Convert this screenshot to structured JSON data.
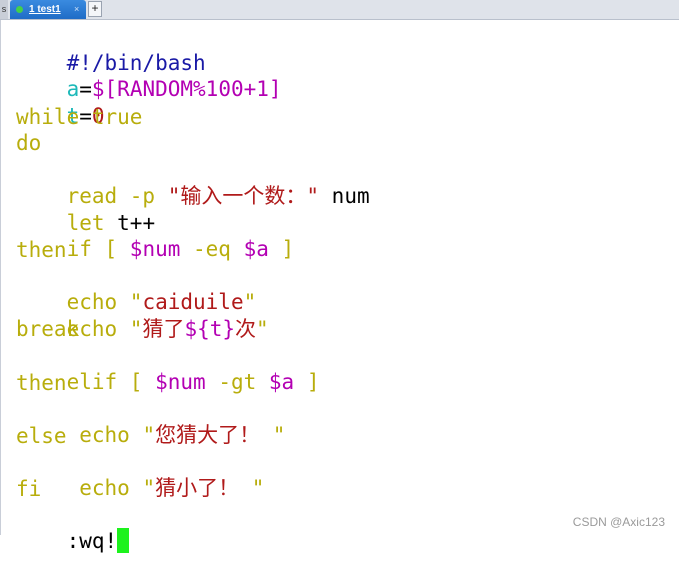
{
  "tabbar": {
    "edge_glyph": "s",
    "tab_label": "1 test1",
    "close_glyph": "×",
    "add_glyph": "+"
  },
  "terminal": {
    "l1": "#!/bin/bash",
    "l2_var": "a",
    "l2_eq": "=",
    "l2_expr": "$[RANDOM%100+1]",
    "l3_var": "t",
    "l3_eq": "=",
    "l3_val": "0",
    "l4": "while true",
    "l5": "do",
    "l6_kw": "read -p ",
    "l6_str": "\"输入一个数：\"",
    "l6_rest": " num",
    "l7_kw": "let",
    "l7_rest": " t++",
    "l8_a": "if [ ",
    "l8_var1": "$num",
    "l8_b": " -eq ",
    "l8_var2": "$a",
    "l8_c": " ]",
    "l9": "then",
    "l10_kw": "echo ",
    "l10_q1": "\"",
    "l10_str": "caiduile",
    "l10_q2": "\"",
    "l11_kw": "echo ",
    "l11_q1": "\"",
    "l11_str1": "猜了",
    "l11_var": "${t}",
    "l11_str2": "次",
    "l11_q2": "\"",
    "l12": "break",
    "l13_a": "elif [ ",
    "l13_var1": "$num",
    "l13_b": " -gt ",
    "l13_var2": "$a",
    "l13_c": " ]",
    "l14": "then",
    "l15_kw": " echo ",
    "l15_q1": "\"",
    "l15_str": "您猜大了！ ",
    "l15_q2": "\"",
    "l16": "else",
    "l17_kw": " echo ",
    "l17_q1": "\"",
    "l17_str": "猜小了！ ",
    "l17_q2": "\"",
    "l18": "fi",
    "l19": ":wq!"
  },
  "watermark": "CSDN @Axic123",
  "colors": {
    "keyword": "#b8ad0c",
    "string": "#b01a1a",
    "variable": "#b300b3",
    "assign": "#1db9b9",
    "cursor": "#1df21d",
    "tab_active": "#1f6cc6"
  }
}
